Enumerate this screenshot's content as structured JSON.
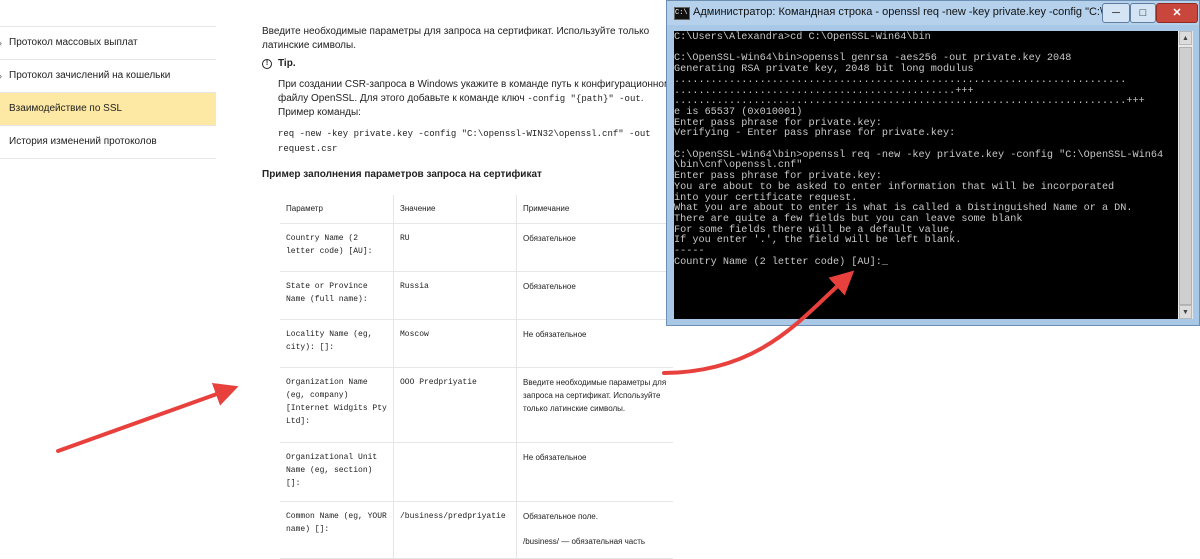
{
  "sidebar": {
    "items": [
      {
        "label": "Протокол массовых выплат",
        "expandable": true,
        "active": false
      },
      {
        "label": "Протокол зачислений на кошельки",
        "expandable": true,
        "active": false
      },
      {
        "label": "Взаимодействие по SSL",
        "expandable": false,
        "active": true
      },
      {
        "label": "История изменений протоколов",
        "expandable": false,
        "active": false
      }
    ],
    "active_color": "#fde9a3"
  },
  "doc": {
    "intro": "Введите необходимые параметры для запроса на сертификат. Используйте только латинские символы.",
    "tip_title": "Tip.",
    "tip_text_1": "При создании CSR-запроса в Windows укажите в команде путь к конфигурационному файлу OpenSSL. Для этого добавьте к команде ключ ",
    "tip_code_1": "-config \"{path}\" -out",
    "tip_text_2": ". Пример команды:",
    "tip_command": "req -new -key private.key -config \"C:\\openssl-WIN32\\openssl.cnf\" -out request.csr",
    "example_title": "Пример заполнения параметров запроса на сертификат"
  },
  "table": {
    "headers": [
      "Параметр",
      "Значение",
      "Примечание"
    ],
    "rows": [
      {
        "param": "Country Name (2 letter code) [AU]:",
        "value": "RU",
        "note": "Обязательное"
      },
      {
        "param": "State or Province Name (full name):",
        "value": "Russia",
        "note": "Обязательное"
      },
      {
        "param": "Locality Name (eg, city): []:",
        "value": "Moscow",
        "note": "Не обязательное"
      },
      {
        "param": "Organization Name (eg, company) [Internet Widgits Pty Ltd]:",
        "value": "OOO Predpriyatie",
        "note": "Введите необходимые параметры для запроса на сертификат. Используйте только латинские символы."
      },
      {
        "param": "Organizational Unit Name (eg, section) []:",
        "value": "",
        "note": "Не обязательное"
      },
      {
        "param": "Common Name (eg, YOUR name) []:",
        "value": "/business/predpriyatie",
        "note": "Обязательное поле.",
        "note_2": "/business/ — обязательная часть"
      }
    ]
  },
  "console_window": {
    "title": "Администратор: Командная строка - openssl  req -new -key private.key -config \"C:\\OpenSSL-Wi...",
    "icon_text": "C:\\",
    "min_label": "─",
    "max_label": "□",
    "close_label": "✕",
    "lines": [
      "C:\\Users\\Alexandra>cd C:\\OpenSSL-Win64\\bin",
      "",
      "C:\\OpenSSL-Win64\\bin>openssl genrsa -aes256 -out private.key 2048",
      "Generating RSA private key, 2048 bit long modulus",
      "..........................................................................",
      "..............................................+++",
      "..........................................................................+++",
      "e is 65537 (0x010001)",
      "Enter pass phrase for private.key:",
      "Verifying - Enter pass phrase for private.key:",
      "",
      "C:\\OpenSSL-Win64\\bin>openssl req -new -key private.key -config \"C:\\OpenSSL-Win64",
      "\\bin\\cnf\\openssl.cnf\"",
      "Enter pass phrase for private.key:",
      "You are about to be asked to enter information that will be incorporated",
      "into your certificate request.",
      "What you are about to enter is what is called a Distinguished Name or a DN.",
      "There are quite a few fields but you can leave some blank",
      "For some fields there will be a default value,",
      "If you enter '.', the field will be left blank.",
      "-----",
      "Country Name (2 letter code) [AU]:_"
    ]
  },
  "colors": {
    "arrow": "#e8413d",
    "window_frame": "#a9c8e6",
    "console_bg": "#000000",
    "console_fg": "#c8c8c8"
  }
}
